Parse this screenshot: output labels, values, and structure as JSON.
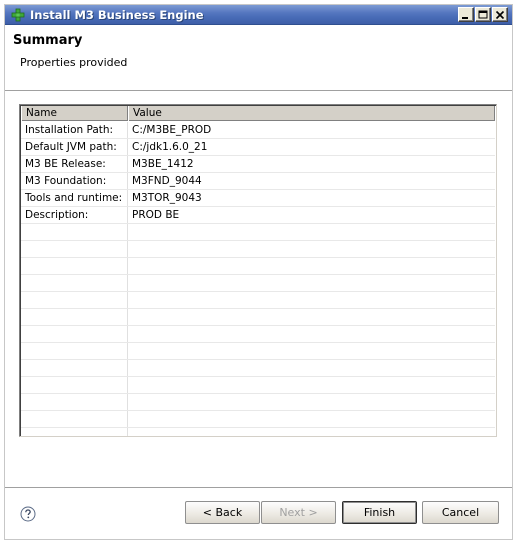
{
  "window": {
    "title": "Install M3 Business Engine",
    "icon": "green-plus-icon",
    "controls": [
      "minimize",
      "maximize",
      "close"
    ]
  },
  "header": {
    "title": "Summary",
    "subtitle": "Properties provided"
  },
  "table": {
    "columns": [
      "Name",
      "Value"
    ],
    "rows": [
      {
        "name": "Installation Path:",
        "value": "C:/M3BE_PROD"
      },
      {
        "name": "Default JVM path:",
        "value": "C:/jdk1.6.0_21"
      },
      {
        "name": "M3 BE Release:",
        "value": "M3BE_1412"
      },
      {
        "name": "M3 Foundation:",
        "value": "M3FND_9044"
      },
      {
        "name": "Tools and runtime:",
        "value": "M3TOR_9043"
      },
      {
        "name": "Description:",
        "value": "PROD BE"
      },
      {
        "name": "",
        "value": ""
      },
      {
        "name": "",
        "value": ""
      },
      {
        "name": "",
        "value": ""
      },
      {
        "name": "",
        "value": ""
      },
      {
        "name": "",
        "value": ""
      },
      {
        "name": "",
        "value": ""
      },
      {
        "name": "",
        "value": ""
      },
      {
        "name": "",
        "value": ""
      },
      {
        "name": "",
        "value": ""
      },
      {
        "name": "",
        "value": ""
      },
      {
        "name": "",
        "value": ""
      },
      {
        "name": "",
        "value": ""
      },
      {
        "name": "",
        "value": ""
      }
    ]
  },
  "footer": {
    "back_label": "< Back",
    "next_label": "Next >",
    "finish_label": "Finish",
    "cancel_label": "Cancel",
    "help_icon": "question-mark-icon"
  },
  "colors": {
    "titlebar": "#4a6db8",
    "button_disabled_text": "#a0a0a0"
  }
}
